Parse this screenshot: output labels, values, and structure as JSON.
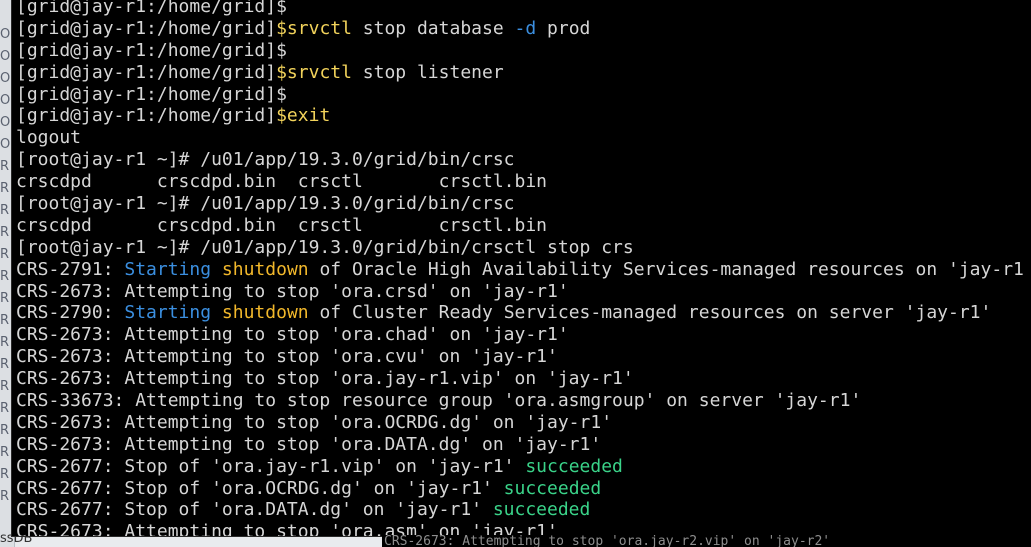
{
  "background": {
    "left_strip_glyphs": [
      "O",
      "O",
      "O",
      "O",
      "O",
      "O",
      "R",
      "R",
      "R",
      "R",
      "R",
      "R",
      "R",
      "R",
      "R",
      "R",
      "R",
      "R",
      "R",
      "R",
      "R",
      "R",
      "R",
      "R",
      "R",
      "R"
    ],
    "bottom_left_text": "ssDB"
  },
  "terminal": {
    "lines": [
      [
        {
          "t": "[grid@jay-r1:/home/grid]$"
        }
      ],
      [
        {
          "t": "[grid@jay-r1:/home/grid]"
        },
        {
          "t": "$srvctl",
          "c": "yellow"
        },
        {
          "t": " stop database "
        },
        {
          "t": "-d",
          "c": "cyan"
        },
        {
          "t": " prod"
        }
      ],
      [
        {
          "t": "[grid@jay-r1:/home/grid]$"
        }
      ],
      [
        {
          "t": "[grid@jay-r1:/home/grid]"
        },
        {
          "t": "$srvctl",
          "c": "yellow"
        },
        {
          "t": " stop listener"
        }
      ],
      [
        {
          "t": "[grid@jay-r1:/home/grid]$"
        }
      ],
      [
        {
          "t": "[grid@jay-r1:/home/grid]"
        },
        {
          "t": "$exit",
          "c": "yellow"
        }
      ],
      [
        {
          "t": "logout"
        }
      ],
      [
        {
          "t": "[root@jay-r1 ~]# /u01/app/19.3.0/grid/bin/crsc"
        }
      ],
      [
        {
          "t": "crscdpd      crscdpd.bin  crsctl       crsctl.bin"
        }
      ],
      [
        {
          "t": "[root@jay-r1 ~]# /u01/app/19.3.0/grid/bin/crsc"
        }
      ],
      [
        {
          "t": "crscdpd      crscdpd.bin  crsctl       crsctl.bin"
        }
      ],
      [
        {
          "t": "[root@jay-r1 ~]# /u01/app/19.3.0/grid/bin/crsctl stop crs"
        }
      ],
      [
        {
          "t": "CRS-2791: "
        },
        {
          "t": "Starting",
          "c": "cyan"
        },
        {
          "t": " "
        },
        {
          "t": "shutdown",
          "c": "orange"
        },
        {
          "t": " of Oracle High Availability Services-managed resources on 'jay-r1"
        }
      ],
      [
        {
          "t": "CRS-2673: Attempting to stop 'ora.crsd' on 'jay-r1'"
        }
      ],
      [
        {
          "t": "CRS-2790: "
        },
        {
          "t": "Starting",
          "c": "cyan"
        },
        {
          "t": " "
        },
        {
          "t": "shutdown",
          "c": "orange"
        },
        {
          "t": " of Cluster Ready Services-managed resources on server 'jay-r1'"
        }
      ],
      [
        {
          "t": "CRS-2673: Attempting to stop 'ora.chad' on 'jay-r1'"
        }
      ],
      [
        {
          "t": "CRS-2673: Attempting to stop 'ora.cvu' on 'jay-r1'"
        }
      ],
      [
        {
          "t": "CRS-2673: Attempting to stop 'ora.jay-r1.vip' on 'jay-r1'"
        }
      ],
      [
        {
          "t": "CRS-33673: Attempting to stop resource group 'ora.asmgroup' on server 'jay-r1'"
        }
      ],
      [
        {
          "t": "CRS-2673: Attempting to stop 'ora.OCRDG.dg' on 'jay-r1'"
        }
      ],
      [
        {
          "t": "CRS-2673: Attempting to stop 'ora.DATA.dg' on 'jay-r1'"
        }
      ],
      [
        {
          "t": "CRS-2677: Stop of 'ora.jay-r1.vip' on 'jay-r1' "
        },
        {
          "t": "succeeded",
          "c": "green"
        }
      ],
      [
        {
          "t": "CRS-2677: Stop of 'ora.OCRDG.dg' on 'jay-r1' "
        },
        {
          "t": "succeeded",
          "c": "green"
        }
      ],
      [
        {
          "t": "CRS-2677: Stop of 'ora.DATA.dg' on 'jay-r1' "
        },
        {
          "t": "succeeded",
          "c": "green"
        }
      ],
      [
        {
          "t": "CRS-2673: Attempting to stop 'ora.asm' on 'jay-r1'"
        }
      ]
    ],
    "background_window_line": "CRS-2673: Attempting to stop 'ora.jay-r2.vip' on 'jay-r2'"
  },
  "colors": {
    "yellow": "#f2d35b",
    "cyan": "#3b8fe0",
    "green": "#3ad389",
    "orange": "#f2b82b",
    "text": "#d6d6d6",
    "background": "#000000"
  }
}
